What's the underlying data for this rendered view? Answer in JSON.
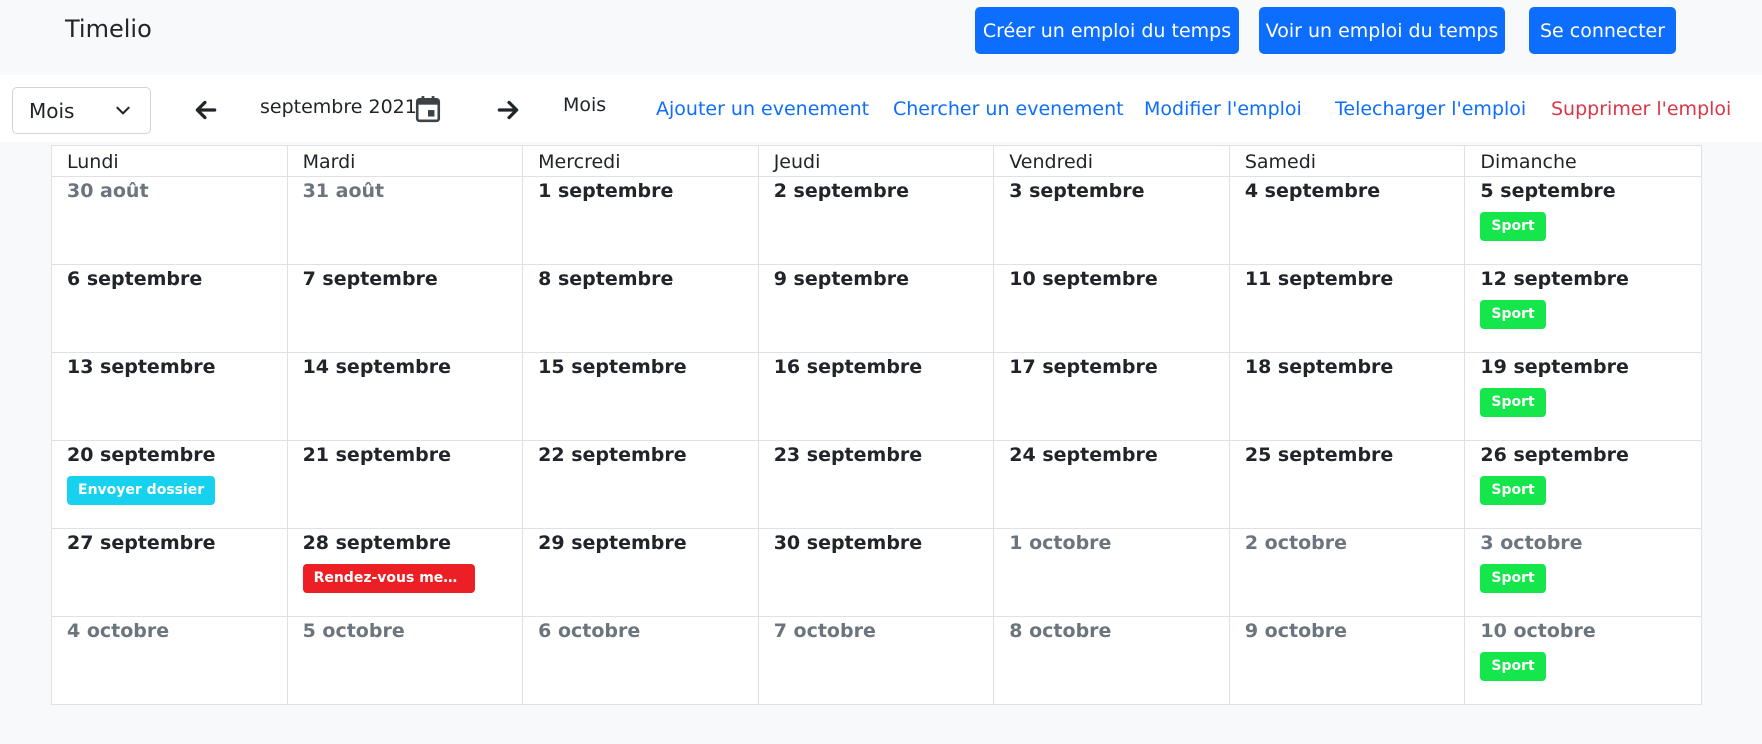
{
  "navbar": {
    "brand": "Timelio",
    "buttons": [
      {
        "label": "Créer un emploi du temps"
      },
      {
        "label": "Voir un emploi du temps"
      },
      {
        "label": "Se connecter"
      }
    ]
  },
  "toolbar": {
    "view_select": "Mois",
    "period": "septembre 2021",
    "current_view": "Mois",
    "links": [
      {
        "label": "Ajouter un evenement"
      },
      {
        "label": "Chercher un evenement"
      },
      {
        "label": "Modifier l'emploi"
      },
      {
        "label": "Telecharger l'emploi"
      },
      {
        "label": "Supprimer l'emploi"
      }
    ]
  },
  "calendar": {
    "weekdays": [
      "Lundi",
      "Mardi",
      "Mercredi",
      "Jeudi",
      "Vendredi",
      "Samedi",
      "Dimanche"
    ],
    "days": [
      {
        "label": "30 août",
        "muted": true
      },
      {
        "label": "31 août",
        "muted": true
      },
      {
        "label": "1 septembre"
      },
      {
        "label": "2 septembre"
      },
      {
        "label": "3 septembre"
      },
      {
        "label": "4 septembre"
      },
      {
        "label": "5 septembre",
        "event": {
          "title": "Sport",
          "color": "#15e64b"
        }
      },
      {
        "label": "6 septembre"
      },
      {
        "label": "7 septembre"
      },
      {
        "label": "8 septembre"
      },
      {
        "label": "9 septembre"
      },
      {
        "label": "10 septembre"
      },
      {
        "label": "11 septembre"
      },
      {
        "label": "12 septembre",
        "event": {
          "title": "Sport",
          "color": "#15e64b"
        }
      },
      {
        "label": "13 septembre"
      },
      {
        "label": "14 septembre"
      },
      {
        "label": "15 septembre"
      },
      {
        "label": "16 septembre"
      },
      {
        "label": "17 septembre"
      },
      {
        "label": "18 septembre"
      },
      {
        "label": "19 septembre",
        "event": {
          "title": "Sport",
          "color": "#15e64b"
        }
      },
      {
        "label": "20 septembre",
        "event": {
          "title": "Envoyer dossier",
          "color": "#17d2ee"
        }
      },
      {
        "label": "21 septembre"
      },
      {
        "label": "22 septembre"
      },
      {
        "label": "23 septembre"
      },
      {
        "label": "24 septembre"
      },
      {
        "label": "25 septembre"
      },
      {
        "label": "26 septembre",
        "event": {
          "title": "Sport",
          "color": "#15e64b"
        }
      },
      {
        "label": "27 septembre"
      },
      {
        "label": "28 septembre",
        "event": {
          "title": "Rendez-vous mede...",
          "color": "#ec1f24"
        }
      },
      {
        "label": "29 septembre"
      },
      {
        "label": "30 septembre"
      },
      {
        "label": "1 octobre",
        "muted": true
      },
      {
        "label": "2 octobre",
        "muted": true
      },
      {
        "label": "3 octobre",
        "muted": true,
        "event": {
          "title": "Sport",
          "color": "#15e64b"
        }
      },
      {
        "label": "4 octobre",
        "muted": true
      },
      {
        "label": "5 octobre",
        "muted": true
      },
      {
        "label": "6 octobre",
        "muted": true
      },
      {
        "label": "7 octobre",
        "muted": true
      },
      {
        "label": "8 octobre",
        "muted": true
      },
      {
        "label": "9 octobre",
        "muted": true
      },
      {
        "label": "10 octobre",
        "muted": true,
        "event": {
          "title": "Sport",
          "color": "#15e64b"
        }
      }
    ]
  },
  "colors": {
    "primary": "#0d6efd",
    "danger": "#dc3545",
    "muted": "#6c757d"
  }
}
